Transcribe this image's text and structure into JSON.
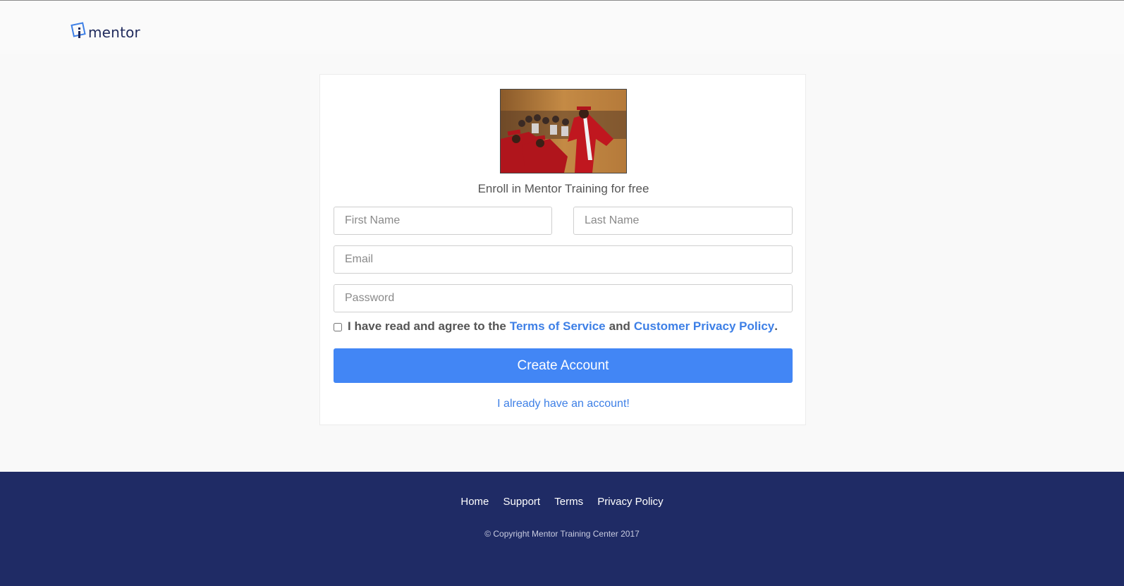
{
  "brand": {
    "logo_text": "mentor"
  },
  "signup": {
    "heading": "Enroll in Mentor Training for free",
    "first_name_placeholder": "First Name",
    "last_name_placeholder": "Last Name",
    "email_placeholder": "Email",
    "password_placeholder": "Password",
    "agree_prefix": "I have read and agree to the",
    "terms_link": "Terms of Service",
    "agree_and": "and",
    "privacy_link": "Customer Privacy Policy",
    "agree_suffix": ".",
    "submit_label": "Create Account",
    "login_link": "I already have an account!"
  },
  "footer": {
    "links": [
      "Home",
      "Support",
      "Terms",
      "Privacy Policy"
    ],
    "copyright": "© Copyright Mentor Training Center 2017"
  },
  "colors": {
    "accent": "#4286f5",
    "link": "#3d7fe6",
    "footer_bg": "#1f2b65",
    "brand_text": "#1f2a5c"
  }
}
